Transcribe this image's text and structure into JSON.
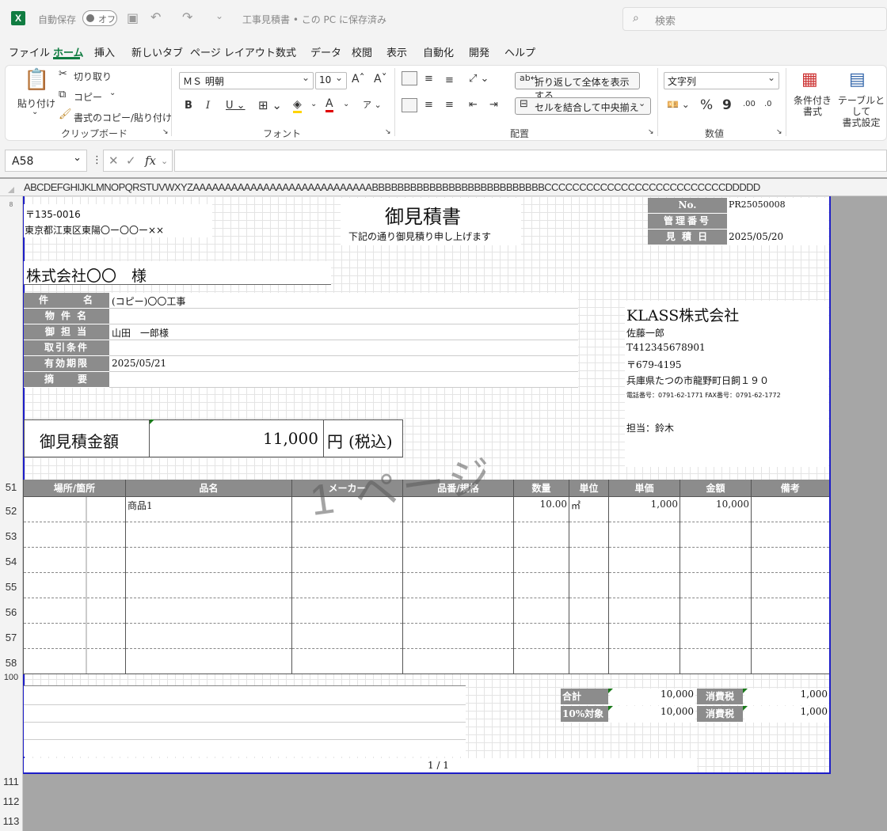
{
  "titlebar": {
    "autosave_label": "自動保存",
    "autosave_state": "オフ",
    "document_title": "工事見積書 • この PC に保存済み",
    "search_placeholder": "検索"
  },
  "menu": [
    "ファイル",
    "ホーム",
    "挿入",
    "新しいタブ",
    "ページ レイアウト",
    "数式",
    "データ",
    "校閲",
    "表示",
    "自動化",
    "開発",
    "ヘルプ"
  ],
  "ribbon": {
    "paste": "貼り付け",
    "cut": "切り取り",
    "copy": "コピー",
    "format_painter": "書式のコピー/貼り付け",
    "clipboard_group": "クリップボード",
    "font_name": "ＭＳ 明朝",
    "font_size": "10",
    "font_group": "フォント",
    "wrap_text": "折り返して全体を表示する",
    "merge_center": "セルを結合して中央揃え",
    "alignment_group": "配置",
    "number_format": "文字列",
    "number_group": "数値",
    "conditional_format": "条件付き\n書式",
    "table_format": "テーブルとして\n書式設定"
  },
  "formula_bar": {
    "name_box": "A58",
    "formula": ""
  },
  "columns_header": "ABCDEFGHIJKLMNOPQRSTUVWXYZAAAAAAAAAAAAAAAAAAAAAAAAAAAABBBBBBBBBBBBBBBBBBBBBBBBBBBCCCCCCCCCCCCCCCCCCCCCCCCCCDDDDD",
  "quote": {
    "postal": "〒135-0016",
    "address": "東京都江東区東陽〇ー〇〇ー××",
    "title": "御見積書",
    "subtitle": "下記の通り御見積り申し上げます",
    "no_label": "No.",
    "no_value": "PR25050008",
    "mgmt_label": "管理番号",
    "mgmt_value": "",
    "date_label": "見 積 日",
    "date_value": "2025/05/20",
    "customer": "株式会社〇〇　様",
    "fields": [
      {
        "label": "件　　　名",
        "value": "(コピー)〇〇工事"
      },
      {
        "label": "物 件 名",
        "value": ""
      },
      {
        "label": "御 担 当",
        "value": "山田　一郎様"
      },
      {
        "label": "取引条件",
        "value": ""
      },
      {
        "label": "有効期限",
        "value": "2025/05/21"
      },
      {
        "label": "摘　　要",
        "value": ""
      }
    ],
    "company": "KLASS株式会社",
    "person": "佐藤一郎",
    "reg_no": "T412345678901",
    "co_postal": "〒679-4195",
    "co_address": "兵庫県たつの市龍野町日飼１９０",
    "co_phone": "電話番号：0791-62-1771 FAX番号：0791-62-1772",
    "contact": "担当：鈴木",
    "total_label": "御見積金額",
    "total_amount": "11,000",
    "total_unit": "円",
    "total_tax": "(税込)",
    "watermark": "1 ページ"
  },
  "items_table": {
    "headers": [
      "場所/箇所",
      "品名",
      "メーカー",
      "品番/規格",
      "数量",
      "単位",
      "単価",
      "金額",
      "備考"
    ],
    "rows": [
      {
        "row": "52",
        "place": "",
        "name": "商品1",
        "maker": "",
        "spec": "",
        "qty": "10.00",
        "unit": "㎡",
        "price": "1,000",
        "amount": "10,000",
        "note": ""
      },
      {
        "row": "53"
      },
      {
        "row": "54"
      },
      {
        "row": "55"
      },
      {
        "row": "56"
      },
      {
        "row": "57"
      },
      {
        "row": "58"
      }
    ]
  },
  "summary": {
    "subtotal_label": "合計",
    "subtotal": "10,000",
    "tax_label": "消費税",
    "tax": "1,000",
    "taxable_label": "10%対象",
    "taxable": "10,000",
    "tax2_label": "消費税",
    "tax2": "1,000"
  },
  "page_indicator": "1 / 1",
  "row_numbers": {
    "r_top": "8",
    "r51": "51",
    "r52": "52",
    "r53": "53",
    "r54": "54",
    "r55": "55",
    "r56": "56",
    "r57": "57",
    "r58": "58",
    "r100": "100",
    "r111": "111",
    "r112": "112",
    "r113": "113"
  }
}
